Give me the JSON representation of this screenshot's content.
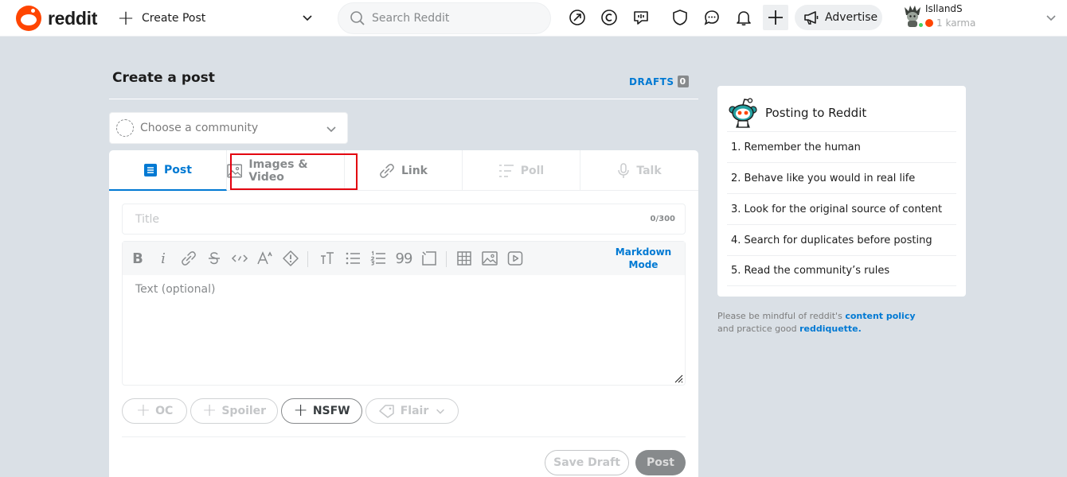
{
  "header": {
    "logo_text": "reddit",
    "create_post_label": "Create Post",
    "search_placeholder": "Search Reddit",
    "advertise_label": "Advertise",
    "username": "IsllandS",
    "karma": "1 karma"
  },
  "main": {
    "page_title": "Create a post",
    "drafts_label": "DRAFTS",
    "drafts_count": "0",
    "community_placeholder": "Choose a community",
    "tabs": [
      {
        "label": "Post",
        "icon": "post-icon",
        "state": "active"
      },
      {
        "label": "Images & Video",
        "icon": "image-icon",
        "state": "highlighted"
      },
      {
        "label": "Link",
        "icon": "link-icon",
        "state": "normal"
      },
      {
        "label": "Poll",
        "icon": "poll-icon",
        "state": "disabled"
      },
      {
        "label": "Talk",
        "icon": "mic-icon",
        "state": "disabled"
      }
    ],
    "title_placeholder": "Title",
    "title_counter": "0/300",
    "markdown_mode_line1": "Markdown",
    "markdown_mode_line2": "Mode",
    "text_placeholder": "Text (optional)",
    "tags": {
      "oc": "OC",
      "spoiler": "Spoiler",
      "nsfw": "NSFW",
      "flair": "Flair"
    },
    "save_draft_label": "Save Draft",
    "post_label": "Post"
  },
  "sidebar": {
    "title": "Posting to Reddit",
    "rules": [
      "1. Remember the human",
      "2. Behave like you would in real life",
      "3. Look for the original source of content",
      "4. Search for duplicates before posting",
      "5. Read the community’s rules"
    ],
    "policy_prefix": "Please be mindful of reddit's",
    "policy_link": "content policy",
    "policy_middle": "and practice good",
    "reddiquette_link": "reddiquette."
  },
  "colors": {
    "brand": "#ff4500",
    "accent": "#0079d3",
    "highlight_border": "#e3000f",
    "background": "#dae0e6"
  }
}
